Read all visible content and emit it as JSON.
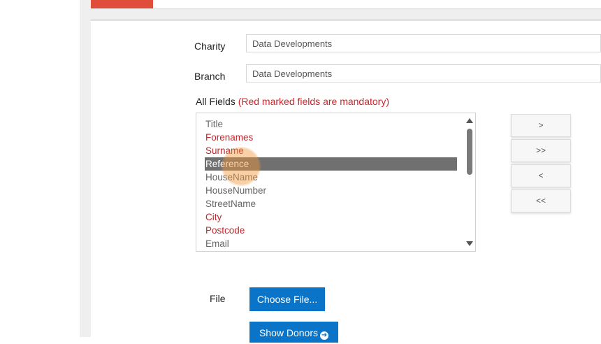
{
  "form": {
    "charity": {
      "label": "Charity",
      "value": "Data Developments"
    },
    "branch": {
      "label": "Branch",
      "value": "Data Developments"
    },
    "all_fields_label": "All Fields",
    "mandatory_note": "(Red marked fields are mandatory)",
    "fields": [
      {
        "label": "Title",
        "mandatory": false,
        "selected": false
      },
      {
        "label": "Forenames",
        "mandatory": true,
        "selected": false
      },
      {
        "label": "Surname",
        "mandatory": true,
        "selected": false
      },
      {
        "label": "Reference",
        "mandatory": false,
        "selected": true
      },
      {
        "label": "HouseName",
        "mandatory": false,
        "selected": false
      },
      {
        "label": "HouseNumber",
        "mandatory": false,
        "selected": false
      },
      {
        "label": "StreetName",
        "mandatory": false,
        "selected": false
      },
      {
        "label": "City",
        "mandatory": true,
        "selected": false
      },
      {
        "label": "Postcode",
        "mandatory": true,
        "selected": false
      },
      {
        "label": "Email",
        "mandatory": false,
        "selected": false
      }
    ],
    "move_buttons": {
      "add": ">",
      "add_all": ">>",
      "remove": "<",
      "remove_all": "<<"
    },
    "file_label": "File",
    "choose_file_label": "Choose File...",
    "show_donors_label": "Show Donors"
  },
  "icons": {
    "show_donors_icon": "arrow-circle-right-icon",
    "scroll_up_icon": "triangle-up-icon",
    "scroll_down_icon": "triangle-down-icon"
  },
  "colors": {
    "accent_red": "#e04d3b",
    "mandatory_red": "#c0272d",
    "primary_blue": "#0a74c9",
    "selected_row": "#707070"
  }
}
